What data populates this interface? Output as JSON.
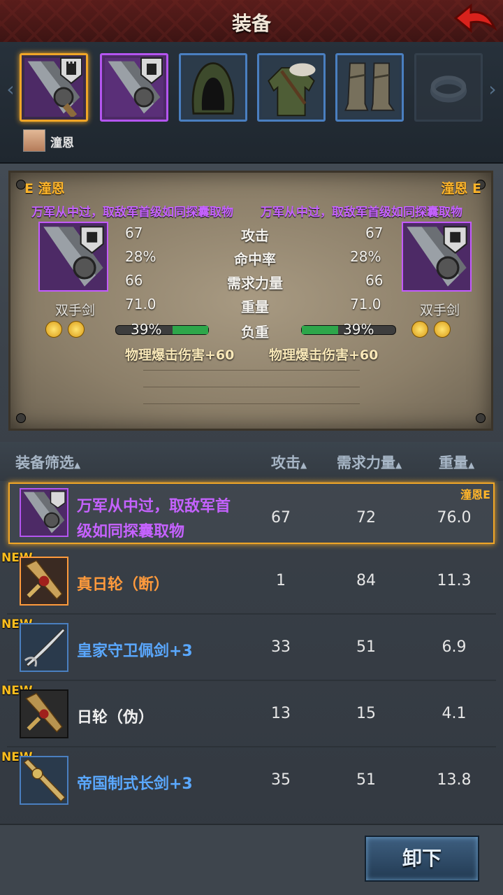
{
  "header": {
    "title": "装备"
  },
  "character": {
    "name": "潼恩"
  },
  "compare": {
    "left": {
      "owner": "E 潼恩",
      "description": "万军从中过，取敌军首级如同探囊取物",
      "attack": "67",
      "accuracy": "28%",
      "strength_req": "66",
      "weight": "71.0",
      "load": "39%",
      "load_fraction": 0.39,
      "weapon_type": "双手剑",
      "bonus": "物理爆击伤害+60"
    },
    "right": {
      "owner": "潼恩 E",
      "description": "万军从中过，取敌军首级如同探囊取物",
      "attack": "67",
      "accuracy": "28%",
      "strength_req": "66",
      "weight": "71.0",
      "load": "39%",
      "load_fraction": 0.39,
      "weapon_type": "双手剑",
      "bonus": "物理爆击伤害+60"
    },
    "labels": {
      "attack": "攻击",
      "accuracy": "命中率",
      "strength_req": "需求力量",
      "weight": "重量",
      "load": "负重"
    }
  },
  "list": {
    "headers": {
      "filter": "装备筛选",
      "attack": "攻击",
      "strength_req": "需求力量",
      "weight": "重量"
    },
    "rows": [
      {
        "name": "万军从中过，取敌军首级如同探囊取物",
        "name_line1": "万军从中过，取敌军首",
        "name_line2": "级如同探囊取物",
        "attack": "67",
        "strength_req": "72",
        "weight": "76.0",
        "tag": "潼恩E",
        "color": "#c562ff"
      },
      {
        "new": "NEW",
        "name": "真日轮（断）",
        "attack": "1",
        "strength_req": "84",
        "weight": "11.3",
        "color": "#ff9a3c"
      },
      {
        "new": "NEW",
        "name": "皇家守卫佩剑+3",
        "attack": "33",
        "strength_req": "51",
        "weight": "6.9",
        "color": "#5aa8ff"
      },
      {
        "new": "NEW",
        "name": "日轮（伪）",
        "attack": "13",
        "strength_req": "15",
        "weight": "4.1",
        "color": "#f0f0f0"
      },
      {
        "new": "NEW",
        "name": "帝国制式长剑+3",
        "attack": "35",
        "strength_req": "51",
        "weight": "13.8",
        "color": "#5aa8ff"
      }
    ]
  },
  "actions": {
    "unequip": "卸下"
  },
  "colors": {
    "accent_orange": "#ffb52a",
    "epic_purple": "#c562ff",
    "rare_blue": "#5aa8ff",
    "legendary_orange": "#ff9a3c"
  }
}
